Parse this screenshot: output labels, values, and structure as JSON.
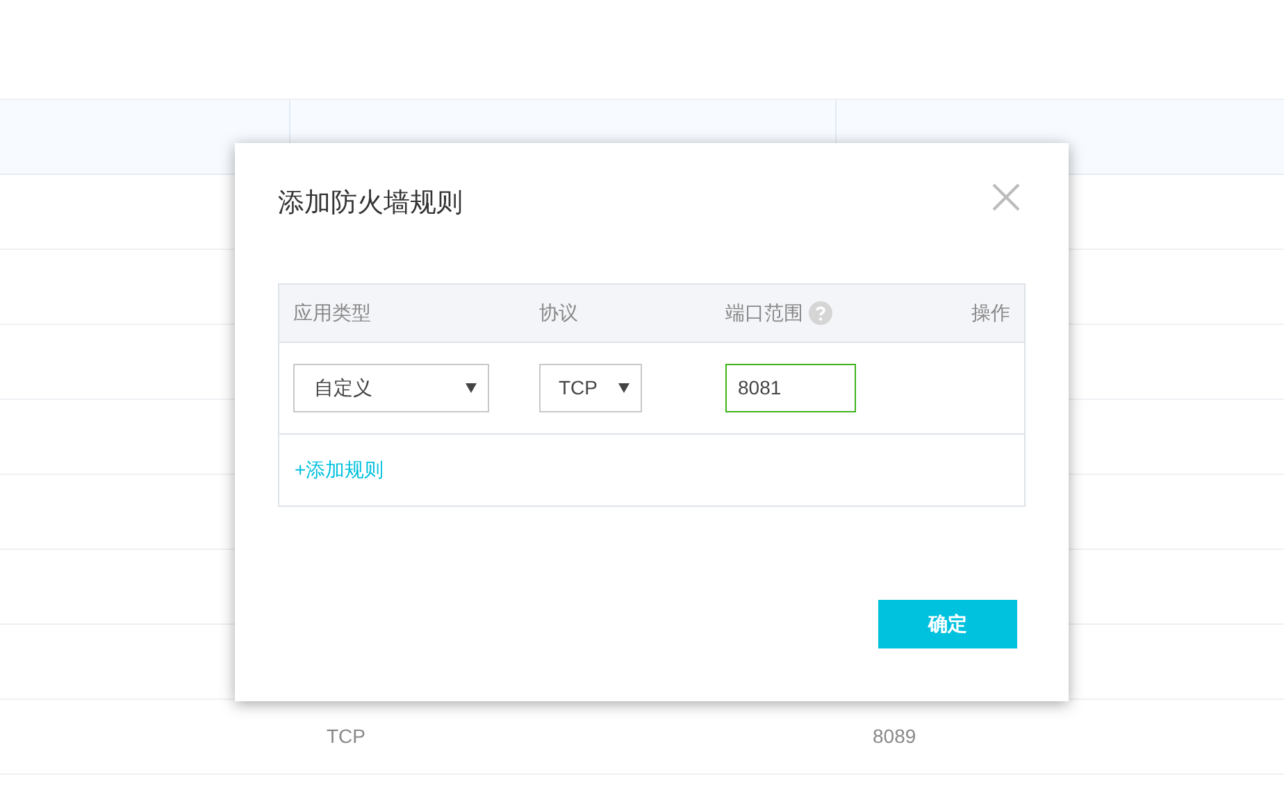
{
  "background_table": {
    "rows": [
      {
        "protocol": "TCP",
        "port_range": "8089"
      }
    ]
  },
  "dialog": {
    "title": "添加防火墙规则",
    "rules_table": {
      "columns": [
        {
          "label": "应用类型",
          "kind": "text"
        },
        {
          "label": "协议",
          "kind": "text"
        },
        {
          "label": "端口范围",
          "kind": "help"
        },
        {
          "label": "操作",
          "kind": "right"
        }
      ],
      "rows": [
        {
          "app_type": "自定义",
          "protocol": "TCP",
          "port_range": "8081",
          "port_focused": true
        }
      ],
      "add_link": "+添加规则"
    },
    "confirm_button": "确定"
  }
}
